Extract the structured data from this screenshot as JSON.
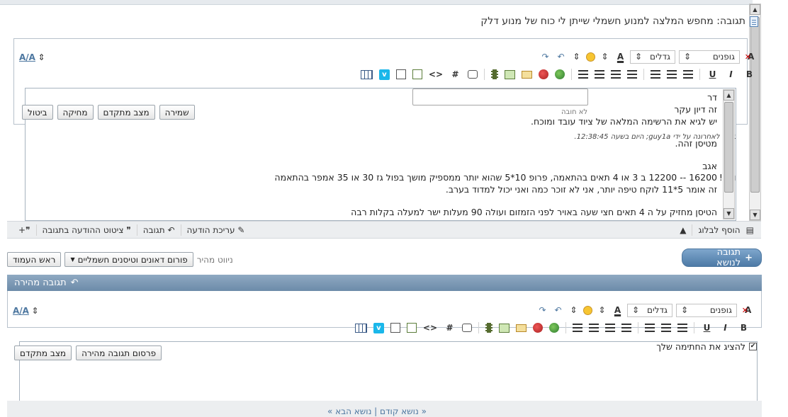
{
  "post": {
    "title": "תגובה: מחפש המלצה למנוע חשמלי שייתן לי כוח של מנוע דלק"
  },
  "toolbar": {
    "font_select": "גופנים",
    "size_select": "גדלים",
    "bold": "B",
    "italic": "I",
    "underline": "U",
    "hash": "#",
    "code": "<>"
  },
  "editor": {
    "lines": [
      "דר",
      "זה דיון עקר",
      "יש לגיא את הרשימה המלאה של ציוד עובד ומוכח.",
      "נערך לאחרונה על ידי guy1a; היום בשעה 12:38:45.",
      "מטיסן זהה.",
      "אגב",
      "16200 -- 12200 ב 3 או 4 תאים בהתאמה, פרופ 10*5 שהוא יותר ממספיק מושך בפול גז 30 או 35 אמפר בהתאמה",
      "זה אומר 5*11 לוקח טיפה יותר, אני לא זוכר כמה ואני יכול למדוד בערב.",
      "הטיסן מחזיק על ה 4 תאים חצי שעה באויר לפני הזמזום ועולה 90 מעלות ישר למעלה בקלות רבה"
    ],
    "overlap_fragment": "ואז !",
    "reason_placeholder": "לא חובה"
  },
  "edit_buttons": {
    "save": "שמירה",
    "advanced": "מצב מתקדם",
    "delete": "מחיקה",
    "cancel": "ביטול"
  },
  "post_actions": {
    "add_blog": "הוסף לבלוג",
    "edit": "עריכת הודעה",
    "reply": "תגובה",
    "quote_reply": "ציטוט ההודעה בתגובה"
  },
  "navigation": {
    "reply_topic": "תגובה לנושא",
    "quick_nav_label": "ניווט מהיר",
    "forum_select": "פורום דאונים וטיסנים חשמליים",
    "top_button": "ראש העמוד"
  },
  "quick_reply": {
    "title": "תגובה מהירה",
    "show_signature": "להציג את החתימה שלך",
    "post_button": "פרסום תגובה מהירה",
    "advanced_button": "מצב מתקדם"
  },
  "footer": {
    "text": "« נושא קודם | נושא הבא »"
  }
}
